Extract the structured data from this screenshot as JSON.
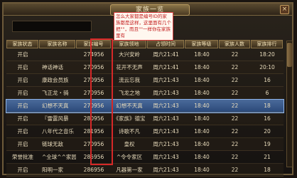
{
  "window": {
    "title": "家族一览",
    "close_label": "×"
  },
  "search": {
    "value": "",
    "placeholder": ""
  },
  "annotation": {
    "text": "怎么大家都是编号ID的家族都是这样，这里面有几个把\"\"，而且\"\"一样你在家族里有"
  },
  "table": {
    "headers": [
      "家族状态",
      "家族名称",
      "家族编号",
      "家族领地",
      "占领时间",
      "家族等级",
      "家族人数",
      "家族排行"
    ],
    "rows": [
      [
        "开启",
        "",
        "274956",
        "大兴安岭",
        "周六21:41",
        "18:40",
        "22",
        "18:20"
      ],
      [
        "开启",
        "神话神话",
        "270956",
        "花开不无声",
        "周六21:41",
        "18:40",
        "22",
        "20:10"
      ],
      [
        "开启",
        "康政会员族",
        "270956",
        "流云忘我",
        "周六21:43",
        "18:40",
        "22",
        "16"
      ],
      [
        "开启",
        "飞正龙・骑",
        "270956",
        "飞龙之地",
        "周六21:43",
        "18:40",
        "22",
        "6"
      ],
      [
        "开启",
        "幻想不天真",
        "270956",
        "幻想不天真",
        "周六21:43",
        "18:40",
        "22",
        "18"
      ],
      [
        "开启",
        "『雷霆风暴",
        "280956",
        "《家族》德宝",
        "周六21:43",
        "18:40",
        "22",
        "16"
      ],
      [
        "开启",
        "八年代之音乐",
        "281956",
        "诗歌不凡",
        "周六21:43",
        "18:40",
        "22",
        "20"
      ],
      [
        "开启",
        "链球无敌",
        "270956",
        "皇权",
        "周六21:43",
        "18:40",
        "22",
        "19"
      ],
      [
        "荣誉批准",
        "^全球^^家园",
        "285956",
        "^令令家区",
        "周六21:43",
        "18:40",
        "22",
        "21"
      ],
      [
        "开启",
        "阳明一家",
        "286956",
        "凡器第一家",
        "周六21:43",
        "18:40",
        "22",
        "18"
      ]
    ],
    "selected_row_index": 4
  },
  "colors": {
    "frame": "#6d5a3a",
    "selected_row": "#2c4a7a",
    "highlight": "#d62828"
  }
}
